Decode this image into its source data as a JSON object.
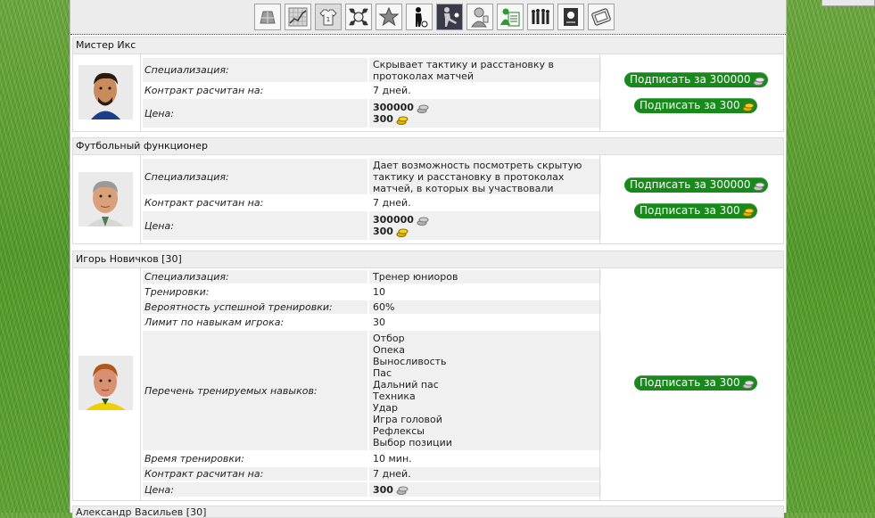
{
  "toolbar": {
    "icons": [
      "field-icon",
      "chart-icon",
      "shirt-icon",
      "emblem-icon",
      "star-icon",
      "player-icon",
      "kick-icon",
      "referee-icon",
      "clipboard-icon",
      "team-icon",
      "card-icon",
      "monitor-icon"
    ]
  },
  "currency": {
    "silver": "silver-coin-icon",
    "gold": "gold-coin-icon"
  },
  "sections": [
    {
      "name": "Мистер Икс",
      "specialization_label": "Специализация:",
      "specialization": "Скрывает тактику и расстановку в протоколах матчей",
      "contract_label": "Контракт расчитан на:",
      "contract": "7 дней.",
      "price_label": "Цена:",
      "price_silver": "300000",
      "price_gold": "300",
      "btn_silver": "Подписать за 300000",
      "btn_gold": "Подписать за 300"
    },
    {
      "name": "Футбольный функционер",
      "specialization_label": "Специализация:",
      "specialization": "Дает возможность посмотреть скрытую тактику и расстановку в протоколах матчей, в которых вы участвовали",
      "contract_label": "Контракт расчитан на:",
      "contract": "7 дней.",
      "price_label": "Цена:",
      "price_silver": "300000",
      "price_gold": "300",
      "btn_silver": "Подписать за 300000",
      "btn_gold": "Подписать за 300"
    },
    {
      "name": "Игорь Новичков [30]",
      "specialization_label": "Специализация:",
      "specialization": "Тренер юниоров",
      "trainings_label": "Тренировки:",
      "trainings": "10",
      "success_label": "Вероятность успешной тренировки:",
      "success": "60%",
      "limit_label": "Лимит по навыкам игрока:",
      "limit": "30",
      "skills_label": "Перечень тренируемых навыков:",
      "skills": [
        "Отбор",
        "Опека",
        "Выносливость",
        "Пас",
        "Дальний пас",
        "Техника",
        "Удар",
        "Игра головой",
        "Рефлексы",
        "Выбор позиции"
      ],
      "time_label": "Время тренировки:",
      "time": "10 мин.",
      "contract_label": "Контракт расчитан на:",
      "contract": "7 дней.",
      "price_label": "Цена:",
      "price_silver": "300",
      "btn_silver": "Подписать за 300"
    }
  ],
  "next_section_name": "Александр Васильев [30]"
}
